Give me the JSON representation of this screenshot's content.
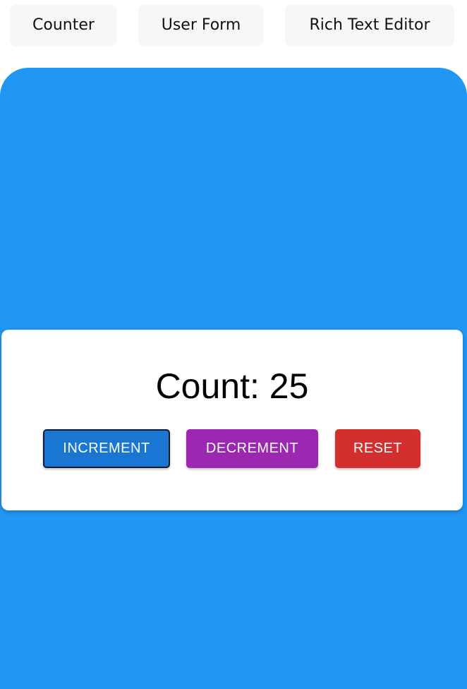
{
  "tabs": [
    {
      "label": "Counter"
    },
    {
      "label": "User Form"
    },
    {
      "label": "Rich Text Editor"
    }
  ],
  "counter": {
    "count_text": "Count: 25",
    "count_value": 25,
    "buttons": {
      "increment": "INCREMENT",
      "decrement": "DECREMENT",
      "reset": "RESET"
    }
  },
  "colors": {
    "stage_background": "#2196f3",
    "increment": "#1976d2",
    "decrement": "#9c27b0",
    "reset": "#d32f2f"
  }
}
